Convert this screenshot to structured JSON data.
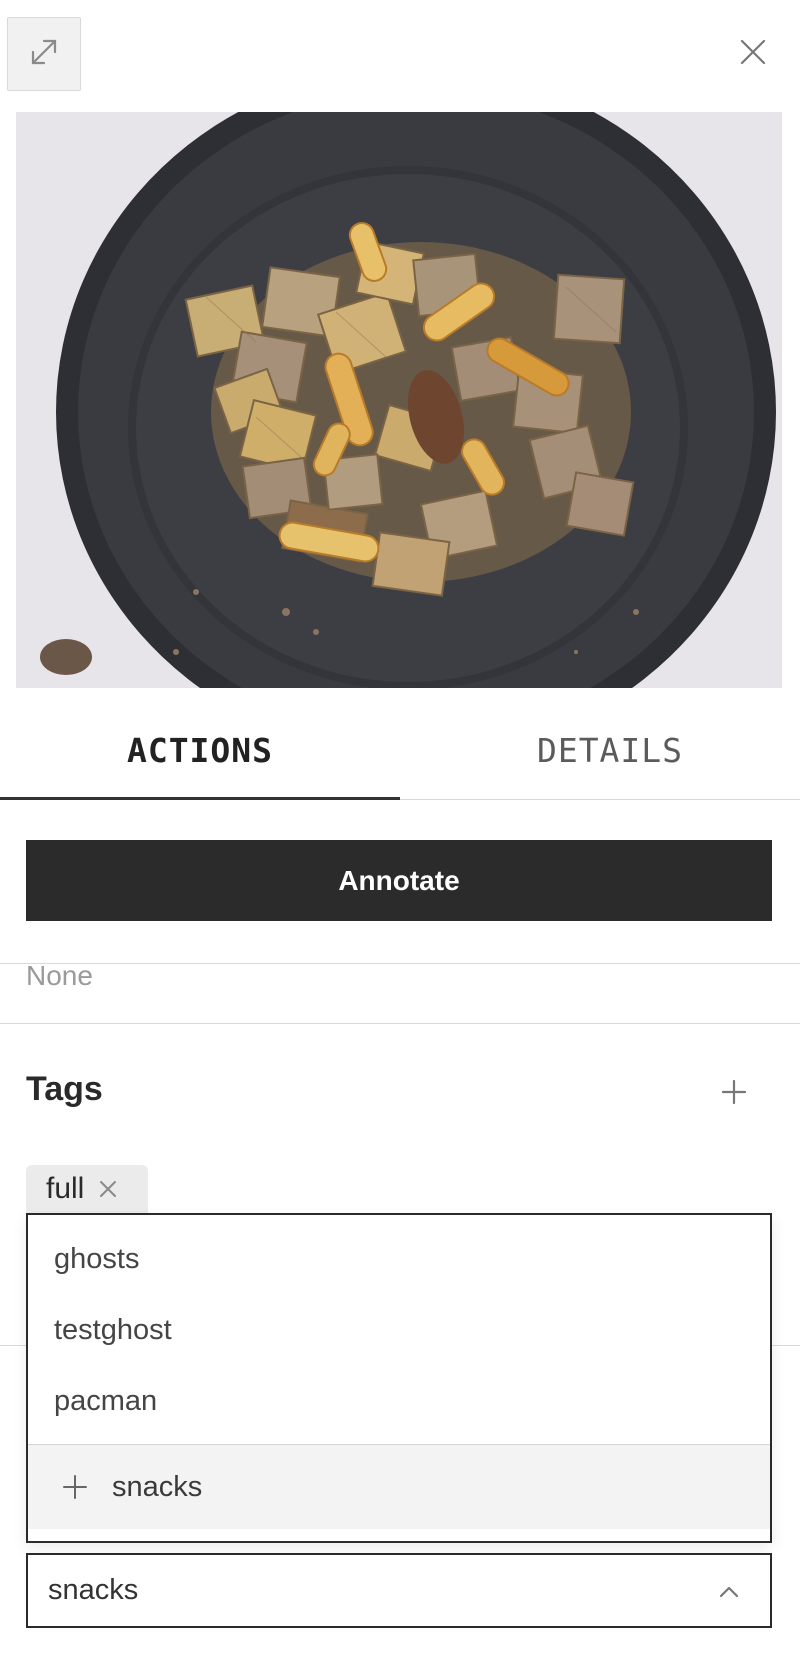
{
  "toolbar": {
    "expand_icon": "expand-diagonal-icon",
    "close_icon": "close-icon"
  },
  "image": {
    "subject": "bowl-of-snack-mix"
  },
  "tabs": [
    {
      "label": "ACTIONS",
      "active": true
    },
    {
      "label": "DETAILS",
      "active": false
    }
  ],
  "actions": {
    "annotate_label": "Annotate",
    "none_text": "None"
  },
  "tags": {
    "heading": "Tags",
    "add_icon": "plus-icon",
    "applied": [
      {
        "label": "full"
      }
    ],
    "suggestions": [
      "ghosts",
      "testghost",
      "pacman"
    ],
    "create_label": "snacks",
    "input_value": "snacks",
    "input_icon": "chevron-up-icon"
  },
  "colors": {
    "primary_button": "#2b2b2b",
    "chip_bg": "#ebebeb",
    "border": "#2a2a2a",
    "muted_text": "#9a9a9a"
  }
}
